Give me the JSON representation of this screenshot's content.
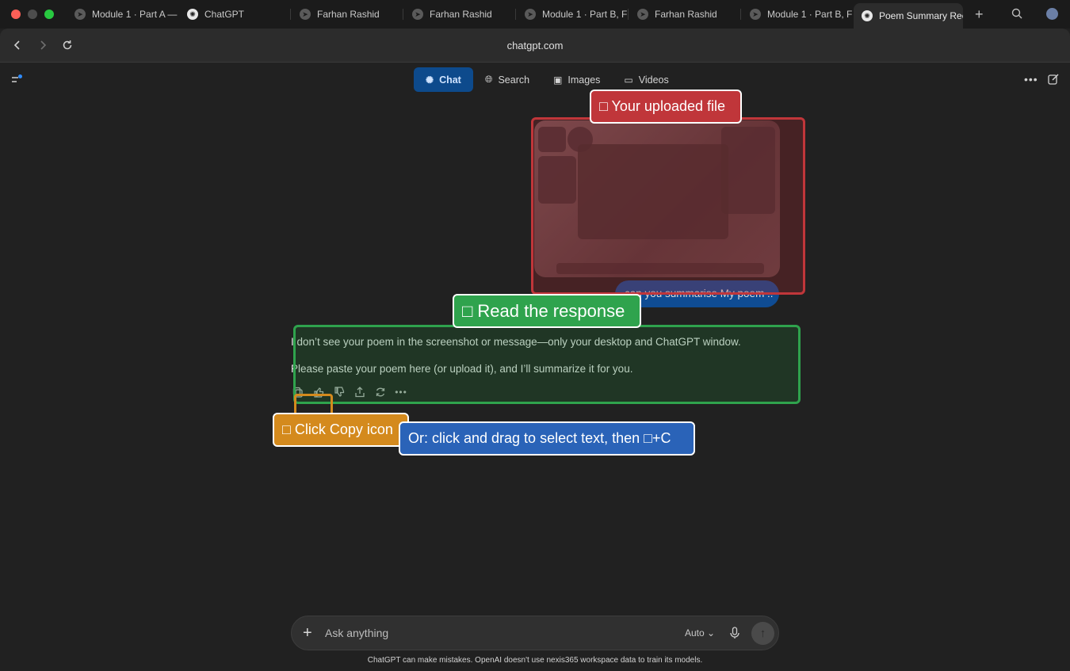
{
  "browser": {
    "tabs": [
      {
        "label": "Module 1 · Part A —",
        "icon": "telegram-icon"
      },
      {
        "label": "ChatGPT",
        "icon": "chatgpt-icon"
      },
      {
        "label": "Farhan Rashid",
        "icon": "telegram-icon"
      },
      {
        "label": "Farhan Rashid",
        "icon": "telegram-icon"
      },
      {
        "label": "Module 1 · Part B, F",
        "icon": "telegram-icon"
      },
      {
        "label": "Farhan Rashid",
        "icon": "telegram-icon"
      },
      {
        "label": "Module 1 · Part B, F",
        "icon": "telegram-icon"
      },
      {
        "label": "Poem Summary Rec",
        "icon": "chatgpt-icon",
        "active": true
      }
    ],
    "url": "chatgpt.com"
  },
  "header": {
    "modes": [
      {
        "label": "Chat",
        "icon": "chatgpt-icon",
        "active": true
      },
      {
        "label": "Search",
        "icon": "globe-icon"
      },
      {
        "label": "Images",
        "icon": "image-icon"
      },
      {
        "label": "Videos",
        "icon": "video-icon"
      }
    ]
  },
  "conversation": {
    "user_message": "can you summarise My poem ..",
    "assistant": {
      "line1": "I don’t see your poem in the screenshot or message—only your desktop and ChatGPT window.",
      "line2": "Please paste your poem here (or upload it), and I’ll summarize it for you."
    }
  },
  "annotations": {
    "uploaded": "□ Your uploaded file",
    "read": "□ Read the response",
    "copy": "□ Click Copy icon",
    "select": "Or: click and drag to select text, then □+C"
  },
  "composer": {
    "placeholder": "Ask anything",
    "model": "Auto"
  },
  "footer": {
    "disclaimer": "ChatGPT can make mistakes. OpenAI doesn't use nexis365 workspace data to train its models."
  },
  "colors": {
    "accent": "#0d4a8c",
    "annotation_red": "#c0363a",
    "annotation_green": "#2fa34d",
    "annotation_orange": "#d48a1d",
    "annotation_blue": "#2a63b8"
  }
}
